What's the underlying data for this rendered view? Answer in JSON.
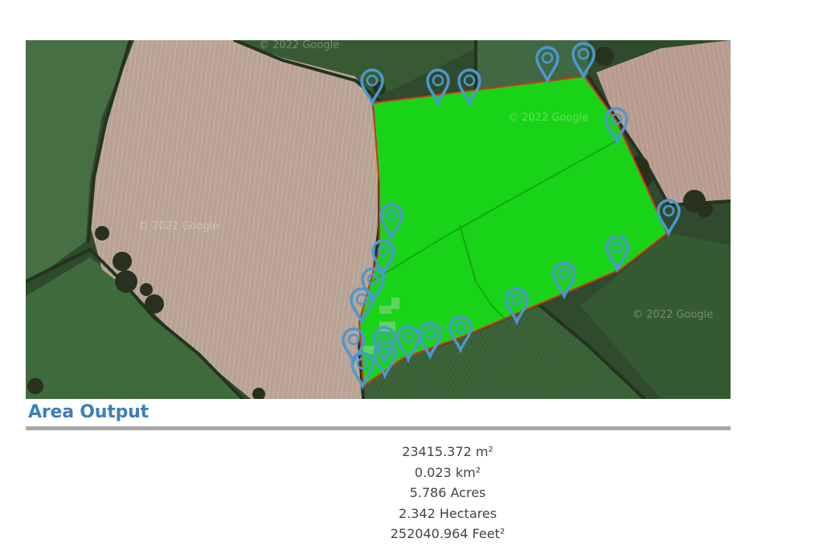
{
  "map": {
    "imagery_watermarks": [
      "© 2022 Google",
      "© 2022 Google",
      "© 2022 Google",
      "© 2022 Google"
    ],
    "colors": {
      "measured_area_fill": "#19d319",
      "boundary_line": "#d2331b",
      "marker": "#4d97d0",
      "ploughed_field": "#b9a193",
      "grass_field": "#3d6a3d",
      "hedgerow": "#2e3d2a"
    },
    "marker_icon": "map-pin-icon",
    "vertex_marker_count": 21
  },
  "area_output": {
    "title": "Area Output",
    "results": [
      {
        "value": "23415.372",
        "unit": "m²"
      },
      {
        "value": "0.023",
        "unit": "km²"
      },
      {
        "value": "5.786",
        "unit": "Acres"
      },
      {
        "value": "2.342",
        "unit": "Hectares"
      },
      {
        "value": "252040.964",
        "unit": "Feet²"
      }
    ]
  }
}
